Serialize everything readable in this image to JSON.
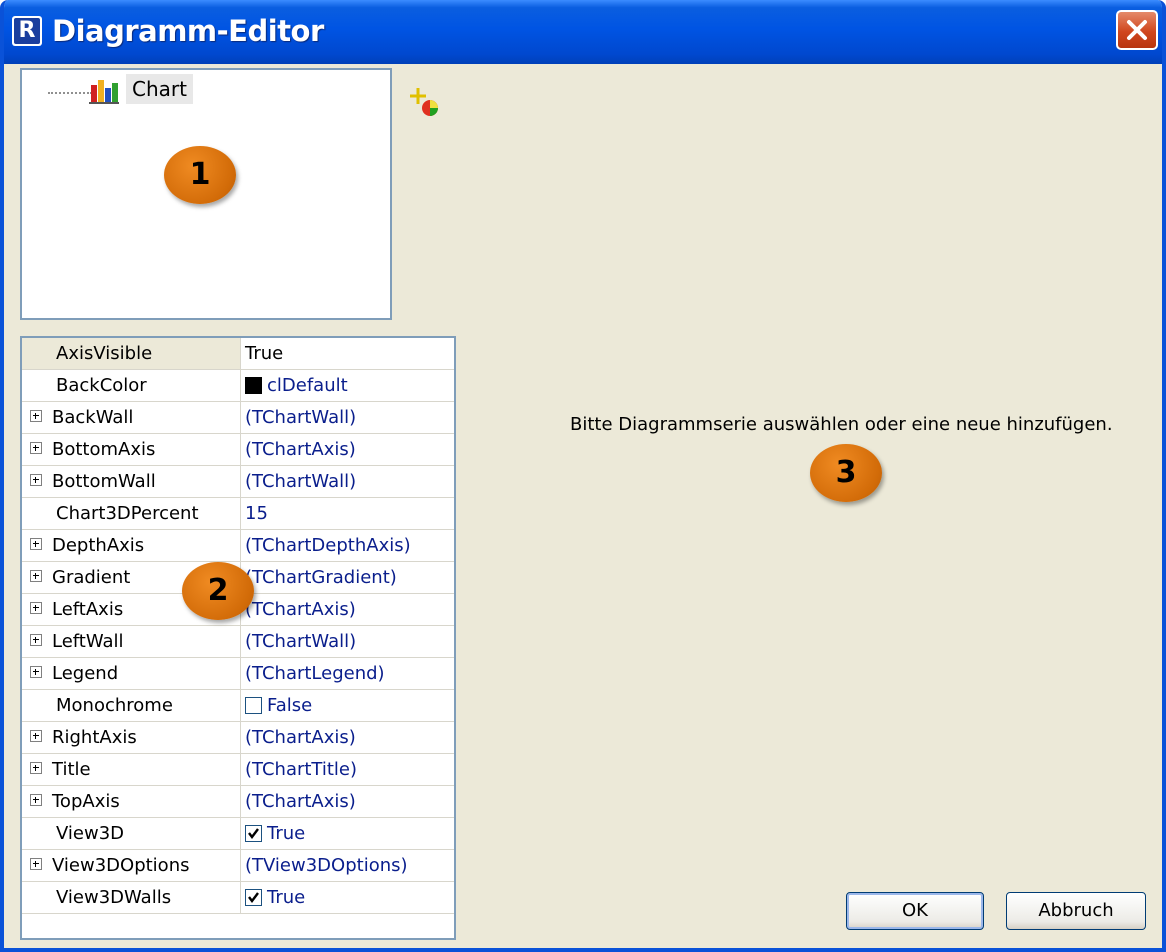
{
  "window": {
    "title": "Diagramm-Editor",
    "app_icon_glyph": "R",
    "colors": {
      "titlebar": "#0054e3",
      "dialog_bg": "#ece9d8",
      "close_button": "#d0461e",
      "badge": "#e07a10",
      "value_text": "#0a1e8c"
    }
  },
  "tree": {
    "nodes": [
      {
        "label": "Chart",
        "icon": "bar-chart-icon"
      }
    ],
    "add_series_icon": "add-series-icon"
  },
  "properties": [
    {
      "name": "AxisVisible",
      "value": "True",
      "expandable": false,
      "selected": true,
      "editor": "dropdown"
    },
    {
      "name": "BackColor",
      "value": "clDefault",
      "expandable": false,
      "editor": "color"
    },
    {
      "name": "BackWall",
      "value": "(TChartWall)",
      "expandable": true
    },
    {
      "name": "BottomAxis",
      "value": "(TChartAxis)",
      "expandable": true
    },
    {
      "name": "BottomWall",
      "value": "(TChartWall)",
      "expandable": true
    },
    {
      "name": "Chart3DPercent",
      "value": "15",
      "expandable": false
    },
    {
      "name": "DepthAxis",
      "value": "(TChartDepthAxis)",
      "expandable": true
    },
    {
      "name": "Gradient",
      "value": "(TChartGradient)",
      "expandable": true
    },
    {
      "name": "LeftAxis",
      "value": "(TChartAxis)",
      "expandable": true
    },
    {
      "name": "LeftWall",
      "value": "(TChartWall)",
      "expandable": true
    },
    {
      "name": "Legend",
      "value": "(TChartLegend)",
      "expandable": true
    },
    {
      "name": "Monochrome",
      "value": "False",
      "expandable": false,
      "editor": "checkbox",
      "checked": false
    },
    {
      "name": "RightAxis",
      "value": "(TChartAxis)",
      "expandable": true
    },
    {
      "name": "Title",
      "value": "(TChartTitle)",
      "expandable": true
    },
    {
      "name": "TopAxis",
      "value": "(TChartAxis)",
      "expandable": true
    },
    {
      "name": "View3D",
      "value": "True",
      "expandable": false,
      "editor": "checkbox",
      "checked": true
    },
    {
      "name": "View3DOptions",
      "value": "(TView3DOptions)",
      "expandable": true
    },
    {
      "name": "View3DWalls",
      "value": "True",
      "expandable": false,
      "editor": "checkbox",
      "checked": true
    }
  ],
  "main": {
    "hint": "Bitte Diagrammserie auswählen oder eine neue hinzufügen."
  },
  "badges": {
    "one": "1",
    "two": "2",
    "three": "3"
  },
  "buttons": {
    "ok": "OK",
    "cancel": "Abbruch"
  }
}
